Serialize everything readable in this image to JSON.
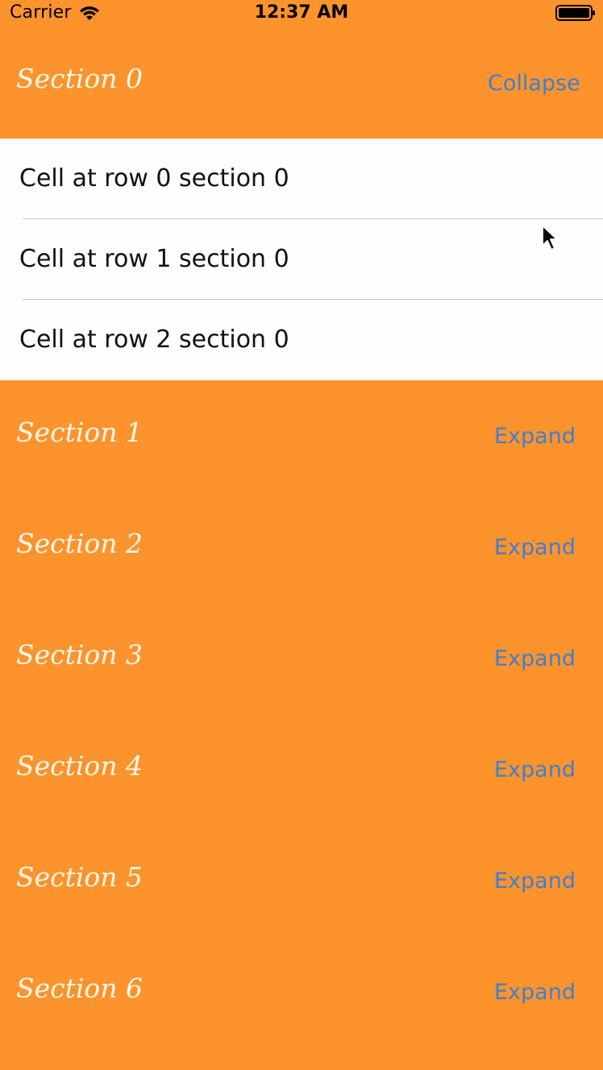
{
  "status_bar": {
    "carrier": "Carrier",
    "time": "12:37 AM",
    "wifi_icon": "wifi-icon",
    "battery_icon": "battery-icon"
  },
  "sections": [
    {
      "title": "Section 0",
      "action": "Collapse"
    },
    {
      "title": "Section 1",
      "action": "Expand"
    },
    {
      "title": "Section 2",
      "action": "Expand"
    },
    {
      "title": "Section 3",
      "action": "Expand"
    },
    {
      "title": "Section 4",
      "action": "Expand"
    },
    {
      "title": "Section 5",
      "action": "Expand"
    },
    {
      "title": "Section 6",
      "action": "Expand"
    }
  ],
  "cells": [
    {
      "label": "Cell at row 0 section 0"
    },
    {
      "label": "Cell at row 1 section 0"
    },
    {
      "label": "Cell at row 2 section 0"
    }
  ],
  "colors": {
    "header_background": "#fd932c",
    "header_title": "#fff8ec",
    "button_text": "#3f7fd0",
    "cell_background": "#fefefe",
    "separator": "#c8c8c8"
  }
}
